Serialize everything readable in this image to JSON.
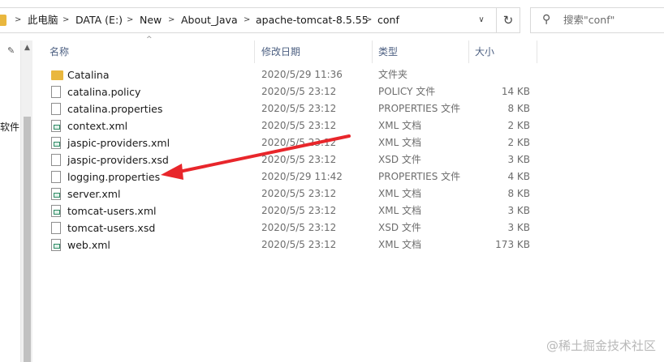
{
  "address_bar": {
    "breadcrumbs": [
      "此电脑",
      "DATA (E:)",
      "New",
      "About_Java",
      "apache-tomcat-8.5.55",
      "conf"
    ],
    "separator": ">",
    "dropdown_glyph": "∨"
  },
  "toolbar": {
    "refresh_glyph": "↻"
  },
  "search": {
    "icon_glyph": "⚲",
    "placeholder": "搜索\"conf\""
  },
  "nav": {
    "pin_glyph": "✎",
    "partial_label": "软件:"
  },
  "columns": {
    "name": "名称",
    "date": "修改日期",
    "type": "类型",
    "size": "大小"
  },
  "files": [
    {
      "name": "Catalina",
      "date": "2020/5/29 11:36",
      "type": "文件夹",
      "size": "",
      "icon": "folder-icon"
    },
    {
      "name": "catalina.policy",
      "date": "2020/5/5 23:12",
      "type": "POLICY 文件",
      "size": "14 KB",
      "icon": "file-icon"
    },
    {
      "name": "catalina.properties",
      "date": "2020/5/5 23:12",
      "type": "PROPERTIES 文件",
      "size": "8 KB",
      "icon": "file-icon"
    },
    {
      "name": "context.xml",
      "date": "2020/5/5 23:12",
      "type": "XML 文档",
      "size": "2 KB",
      "icon": "xml-file-icon"
    },
    {
      "name": "jaspic-providers.xml",
      "date": "2020/5/5 23:12",
      "type": "XML 文档",
      "size": "2 KB",
      "icon": "xml-file-icon"
    },
    {
      "name": "jaspic-providers.xsd",
      "date": "2020/5/5 23:12",
      "type": "XSD 文件",
      "size": "3 KB",
      "icon": "file-icon"
    },
    {
      "name": "logging.properties",
      "date": "2020/5/29 11:42",
      "type": "PROPERTIES 文件",
      "size": "4 KB",
      "icon": "file-icon"
    },
    {
      "name": "server.xml",
      "date": "2020/5/5 23:12",
      "type": "XML 文档",
      "size": "8 KB",
      "icon": "xml-file-icon"
    },
    {
      "name": "tomcat-users.xml",
      "date": "2020/5/5 23:12",
      "type": "XML 文档",
      "size": "3 KB",
      "icon": "xml-file-icon"
    },
    {
      "name": "tomcat-users.xsd",
      "date": "2020/5/5 23:12",
      "type": "XSD 文件",
      "size": "3 KB",
      "icon": "file-icon"
    },
    {
      "name": "web.xml",
      "date": "2020/5/5 23:12",
      "type": "XML 文档",
      "size": "173 KB",
      "icon": "xml-file-icon"
    }
  ],
  "annotation": {
    "color": "#e8262b",
    "target": "logging.properties"
  },
  "watermark": {
    "text": "@稀土掘金技术社区"
  },
  "colors": {
    "folder": "#e9b73e",
    "header_text": "#4d6082",
    "border": "#d9d9d9"
  }
}
